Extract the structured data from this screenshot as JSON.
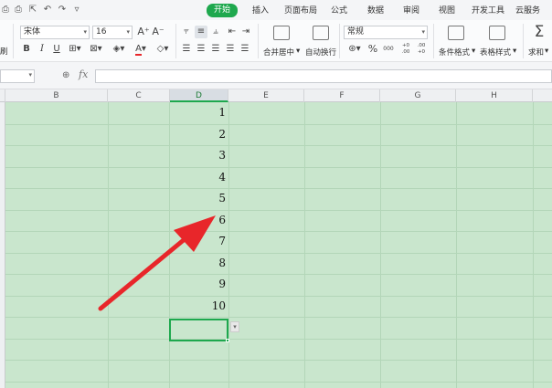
{
  "quick_access": {
    "icons": [
      "print-preview-icon",
      "print-icon",
      "export-icon",
      "undo-icon",
      "redo-icon",
      "more-icon"
    ]
  },
  "ribbon_tabs": [
    {
      "label": "开始",
      "active": true
    },
    {
      "label": "插入",
      "active": false
    },
    {
      "label": "页面布局",
      "active": false
    },
    {
      "label": "公式",
      "active": false
    },
    {
      "label": "数据",
      "active": false
    },
    {
      "label": "审阅",
      "active": false
    },
    {
      "label": "视图",
      "active": false
    },
    {
      "label": "开发工具",
      "active": false
    },
    {
      "label": "云服务",
      "active": false
    }
  ],
  "ribbon": {
    "font_name": "宋体",
    "font_size": "16",
    "bold": "B",
    "italic": "I",
    "underline": "U",
    "increase_font": "A⁺",
    "decrease_font": "A⁻",
    "font_color_letter": "A",
    "clipboard_label": "刷",
    "merge_center_label": "合并居中",
    "wrap_text_label": "自动换行",
    "number_format": "常规",
    "percent": "%",
    "thousands": "000",
    "increase_decimal": "+0 .00",
    "decrease_decimal": ".00 +0",
    "conditional_format_label": "条件格式",
    "table_style_label": "表格样式",
    "sum_label": "求和",
    "sum_symbol": "Σ"
  },
  "formula_bar": {
    "name_box": "",
    "fx_label": "fx",
    "formula": ""
  },
  "grid": {
    "columns": [
      "B",
      "C",
      "D",
      "E",
      "F",
      "G",
      "H"
    ],
    "selected_column": "D",
    "column_d_values": [
      "1",
      "2",
      "3",
      "4",
      "5",
      "6",
      "7",
      "8",
      "9",
      "10"
    ],
    "active_cell_value": ""
  },
  "colors": {
    "accent": "#1ea84e",
    "grid_background": "#c9e6cd",
    "arrow": "#e8262a"
  }
}
